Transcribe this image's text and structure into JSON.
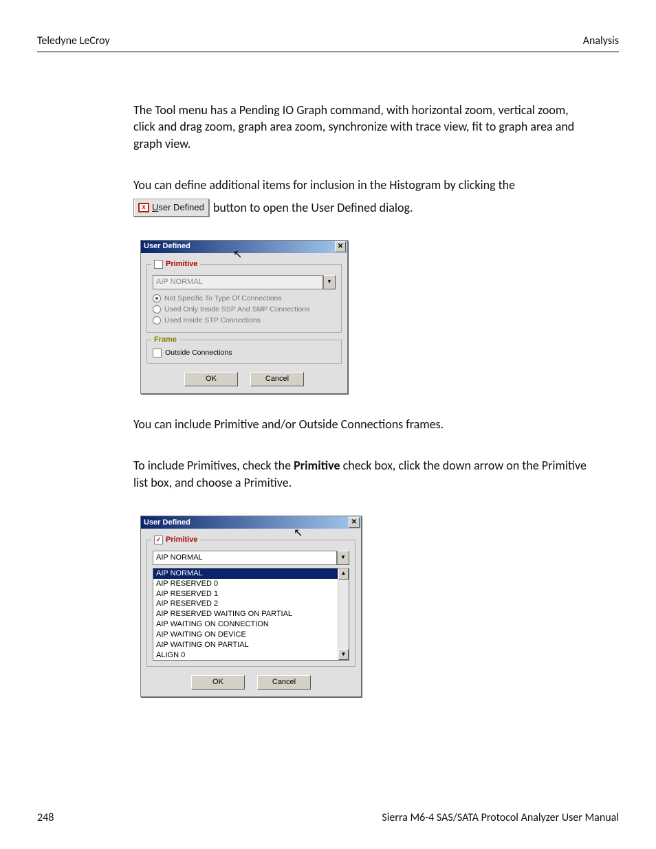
{
  "header": {
    "left": "Teledyne LeCroy",
    "right": "Analysis"
  },
  "paras": {
    "p1": "The Tool menu has a Pending IO Graph command, with horizontal zoom, vertical zoom, click and drag zoom, graph area zoom, synchronize with trace view, fit to graph area and graph view.",
    "p2": "You can define additional items for inclusion in the Histogram by clicking the",
    "p2_tail": " button to open the User Defined dialog.",
    "p3": "You can include Primitive and/or Outside Connections frames.",
    "p4_a": "To include Primitives, check the ",
    "p4_b": "Primitive",
    "p4_c": " check box, click the down arrow on the Primitive list box, and choose a Primitive."
  },
  "inline_button": {
    "label_u": "U",
    "label_rest": "ser Defined",
    "icon_glyph": "x"
  },
  "dialog1": {
    "title": "User Defined",
    "primitive_legend": "Primitive",
    "primitive_checked": false,
    "combo_value": "AIP NORMAL",
    "radios": {
      "r1": "Not Specific To Type Of Connections",
      "r2": "Used Only Inside SSP And SMP Connections",
      "r3": "Used Inside STP Connections"
    },
    "frame_legend": "Frame",
    "outside_label": "Outside Connections",
    "ok": "OK",
    "cancel": "Cancel"
  },
  "dialog2": {
    "title": "User Defined",
    "primitive_legend": "Primitive",
    "primitive_checked": true,
    "combo_value": "AIP NORMAL",
    "options": [
      "AIP NORMAL",
      "AIP RESERVED 0",
      "AIP RESERVED 1",
      "AIP RESERVED 2",
      "AIP RESERVED WAITING ON PARTIAL",
      "AIP WAITING ON CONNECTION",
      "AIP WAITING ON DEVICE",
      "AIP WAITING ON PARTIAL",
      "ALIGN 0"
    ],
    "ok": "OK",
    "cancel": "Cancel"
  },
  "footer": {
    "page": "248",
    "manual": "Sierra M6-4 SAS/SATA Protocol Analyzer User Manual"
  }
}
